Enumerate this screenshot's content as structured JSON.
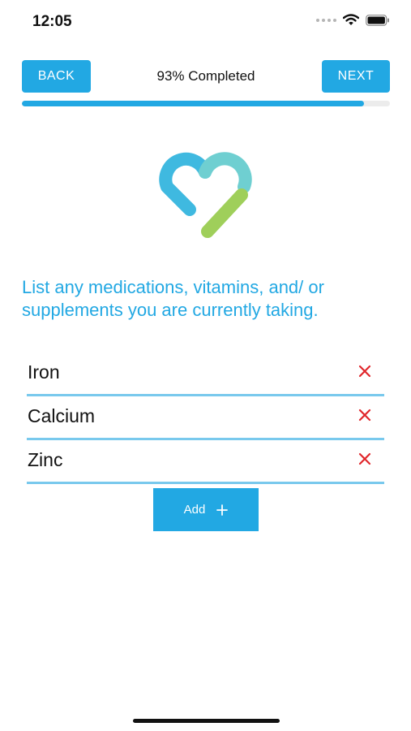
{
  "status_bar": {
    "time": "12:05",
    "icons": [
      "signal-dots-icon",
      "wifi-icon",
      "battery-icon"
    ]
  },
  "nav": {
    "back_label": "BACK",
    "next_label": "NEXT",
    "progress_text": "93% Completed",
    "progress_fraction": 0.93
  },
  "logo": {
    "icon": "heart-logo-icon"
  },
  "question": "List any medications, vitamins, and/ or supplements you are currently taking.",
  "items": [
    {
      "label": "Iron"
    },
    {
      "label": "Calcium"
    },
    {
      "label": "Zinc"
    }
  ],
  "add_button": {
    "label": "Add",
    "icon": "plus-icon"
  },
  "colors": {
    "accent": "#22a8e3",
    "divider": "#79c9ed",
    "remove": "#e0262b",
    "logo_blue": "#3fb9e0",
    "logo_teal": "#6fcfd1",
    "logo_green": "#9fcf5a"
  }
}
